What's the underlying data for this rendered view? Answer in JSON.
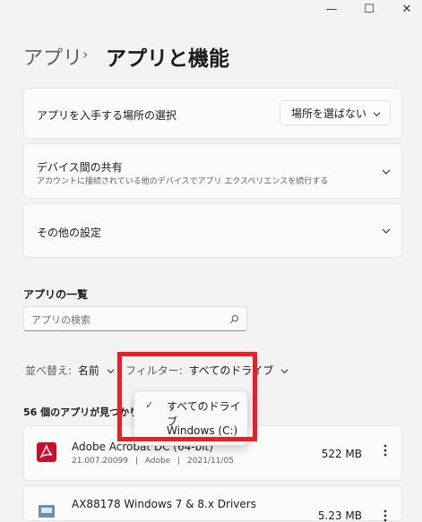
{
  "window": {
    "minimize_glyph": "—",
    "maximize_glyph": "☐",
    "close_glyph": "✕"
  },
  "breadcrumb": {
    "parent": "アプリ",
    "separator": "›",
    "current": "アプリと機能"
  },
  "cards": {
    "install_source": {
      "label": "アプリを入手する場所の選択",
      "dropdown_value": "場所を選ばない"
    },
    "share_across_devices": {
      "label": "デバイス間の共有",
      "description": "アカウントに接続されている他のデバイスでアプリ エクスペリエンスを続行する"
    },
    "more_settings": {
      "label": "その他の設定"
    }
  },
  "app_list": {
    "title": "アプリの一覧",
    "search_placeholder": "アプリの検索",
    "sort_label": "並べ替え:",
    "sort_value": "名前",
    "filter_label": "フィルター:",
    "filter_value": "すべてのドライブ",
    "count_text": "56 個のアプリが見つかりました",
    "filter_menu": {
      "options": [
        {
          "label": "すべてのドライブ",
          "selected": true
        },
        {
          "label": "Windows (C:)",
          "selected": false
        }
      ]
    },
    "apps": [
      {
        "name": "Adobe Acrobat DC (64-bit)",
        "version": "21.007.20099",
        "publisher": "Adobe",
        "date": "2021/11/05",
        "size": "522 MB",
        "icon": "acrobat-icon"
      },
      {
        "name": "AX88178 Windows 7 & 8.x Drivers",
        "size": "5.23 MB",
        "icon": "installer-icon"
      }
    ],
    "meta_separator": "|"
  },
  "colors": {
    "background": "#f3f3f3",
    "card": "#fbfbfb",
    "highlight": "#ee1c24",
    "acrobat_red": "#c8102e"
  }
}
